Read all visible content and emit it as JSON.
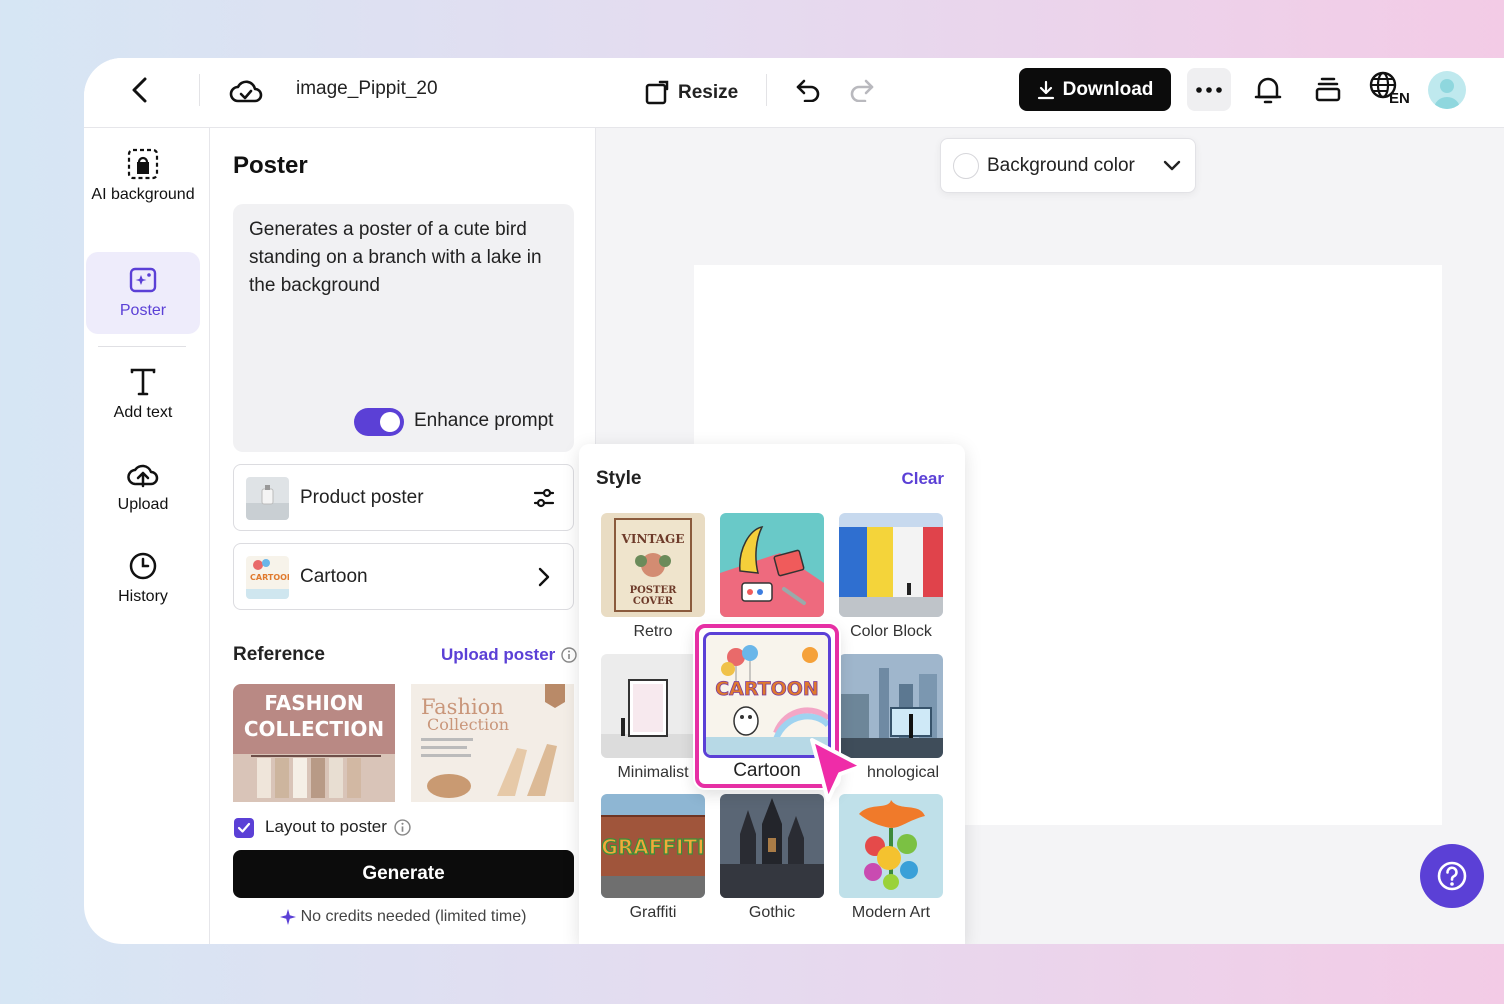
{
  "app": {
    "doc_title": "image_Pippit_20",
    "resize_label": "Resize",
    "download_label": "Download",
    "language_code": "EN"
  },
  "rail": {
    "items": [
      {
        "label": "AI background",
        "icon": "ai-background-icon"
      },
      {
        "label": "Poster",
        "icon": "poster-icon",
        "active": true
      },
      {
        "label": "Add text",
        "icon": "text-icon"
      },
      {
        "label": "Upload",
        "icon": "upload-icon"
      },
      {
        "label": "History",
        "icon": "clock-icon"
      }
    ]
  },
  "panel": {
    "title": "Poster",
    "prompt": "Generates a poster of a cute bird standing on a branch with a lake in the background",
    "enhance_label": "Enhance prompt",
    "enhance_on": true,
    "product_poster_label": "Product poster",
    "style_selected_label": "Cartoon",
    "reference_title": "Reference",
    "upload_poster_label": "Upload poster",
    "reference_thumbs": [
      {
        "line1": "FASHION",
        "line2": "COLLECTION"
      },
      {
        "line1": "Fashion",
        "line2": "Collection"
      }
    ],
    "layout_label": "Layout to poster",
    "layout_checked": true,
    "generate_label": "Generate",
    "credits_note": "No credits needed (limited time)"
  },
  "canvas": {
    "background_color_label": "Background color"
  },
  "style_popup": {
    "title": "Style",
    "clear_label": "Clear",
    "styles": [
      {
        "label": "Retro",
        "thumb_line1": "VINTAGE",
        "thumb_line2": "POSTER",
        "thumb_line3": "COVER"
      },
      {
        "label": "",
        "thumb": "banana-still-life"
      },
      {
        "label": "Color Block"
      },
      {
        "label": "Minimalist"
      },
      {
        "label": "Cartoon",
        "thumb_text": "CARTOON",
        "selected": true
      },
      {
        "label": "hnological"
      },
      {
        "label": "Graffiti",
        "thumb_text": "GRAFFITI"
      },
      {
        "label": "Gothic"
      },
      {
        "label": "Modern Art"
      }
    ]
  },
  "colors": {
    "accent": "#5b40d6",
    "highlight": "#e62fa4",
    "primary_button": "#0c0c0c"
  }
}
